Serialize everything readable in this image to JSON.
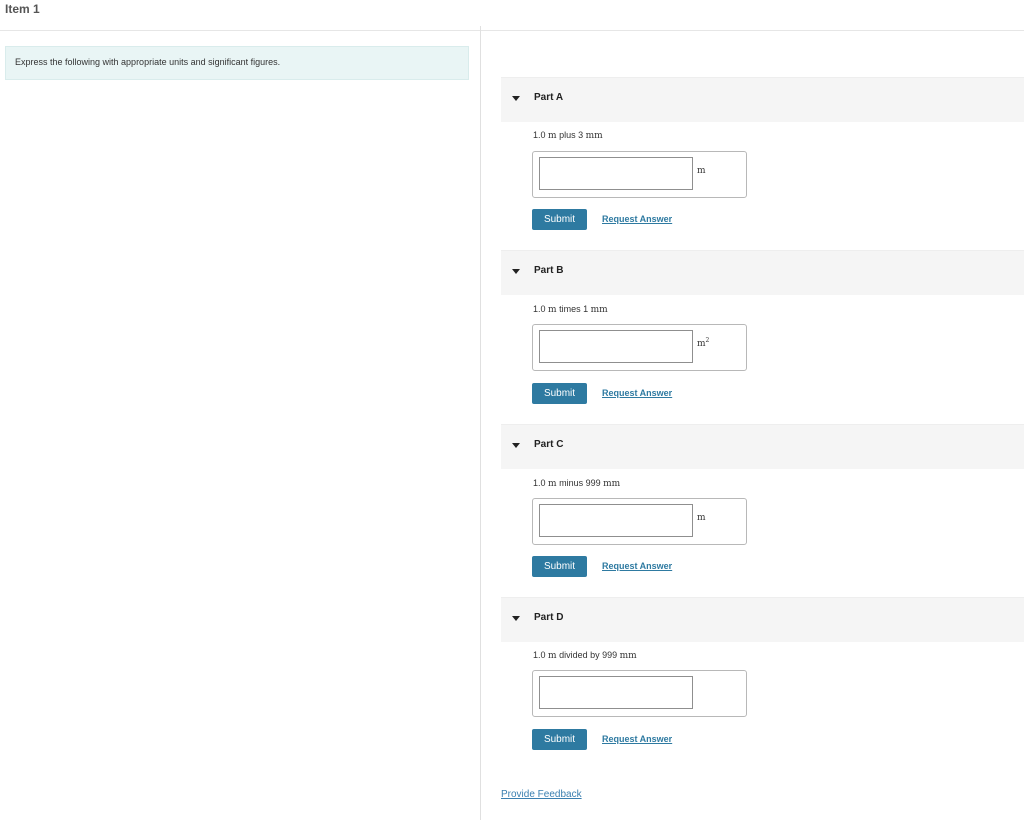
{
  "item_title": "Item 1",
  "intro_text": "Express the following with appropriate units and significant figures.",
  "parts": [
    {
      "label": "Part A",
      "q_value": "1.0",
      "q_u1": "m",
      "q_op": " plus 3 ",
      "q_u2": "mm",
      "unit": "m",
      "unit_exp": "",
      "input_value": "",
      "submit_label": "Submit",
      "request_label": "Request Answer"
    },
    {
      "label": "Part B",
      "q_value": "1.0",
      "q_u1": "m",
      "q_op": " times 1 ",
      "q_u2": "mm",
      "unit": "m",
      "unit_exp": "2",
      "input_value": "",
      "submit_label": "Submit",
      "request_label": "Request Answer"
    },
    {
      "label": "Part C",
      "q_value": "1.0",
      "q_u1": "m",
      "q_op": " minus 999 ",
      "q_u2": "mm",
      "unit": "m",
      "unit_exp": "",
      "input_value": "",
      "submit_label": "Submit",
      "request_label": "Request Answer"
    },
    {
      "label": "Part D",
      "q_value": "1.0",
      "q_u1": "m",
      "q_op": " divided by 999 ",
      "q_u2": "mm",
      "unit": "",
      "unit_exp": "",
      "input_value": "",
      "submit_label": "Submit",
      "request_label": "Request Answer"
    }
  ],
  "feedback_label": "Provide Feedback",
  "colors": {
    "accent": "#2e7aa1",
    "intro_bg": "#e9f5f5",
    "header_bg": "#f5f5f5"
  }
}
